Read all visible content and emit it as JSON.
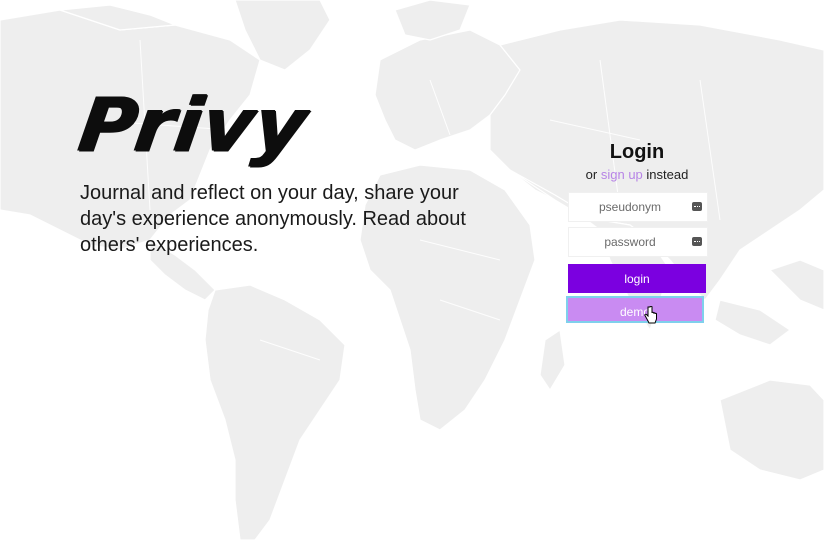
{
  "brand": {
    "logo_text": "Privy",
    "tagline": "Journal and reflect on your day, share your day's experience anonymously. Read about others' experiences."
  },
  "login": {
    "title": "Login",
    "sub_prefix": "or",
    "signup_link": "sign up",
    "sub_suffix": "instead",
    "pseudonym_placeholder": "pseudonym",
    "password_placeholder": "password",
    "login_button": "login",
    "demo_button": "demo"
  },
  "icons": {
    "field_icon": "key-icon",
    "cursor": "hand-pointer-icon",
    "background": "world-map"
  },
  "colors": {
    "primary": "#7b00e0",
    "demo": "#c98bf2",
    "link": "#b784e6",
    "map": "#eeeeee"
  }
}
